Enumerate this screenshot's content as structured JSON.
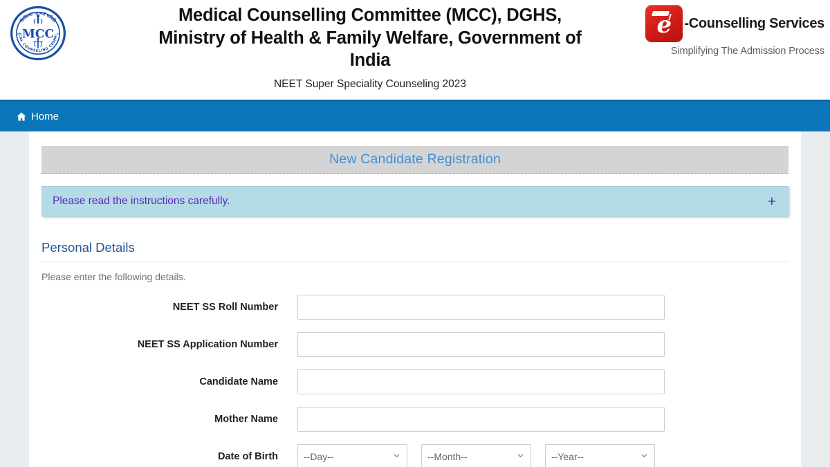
{
  "header": {
    "title": "Medical Counselling Committee (MCC), DGHS, Ministry of Health & Family Welfare, Government of India",
    "subtitle": "NEET Super Speciality Counseling 2023",
    "left_logo_alt": "mcc-seal-logo",
    "right_logo": {
      "name": "-Counselling Services",
      "tagline": "Simplifying The Admission Process",
      "badge_letter": "e"
    }
  },
  "nav": {
    "items": [
      {
        "label": "Home",
        "icon": "home-icon"
      }
    ]
  },
  "panel": {
    "title": "New Candidate Registration"
  },
  "alert": {
    "text": "Please read the instructions carefully.",
    "toggle": "+"
  },
  "section": {
    "title": "Personal Details",
    "subtitle": "Please enter the following details."
  },
  "form": {
    "fields": [
      {
        "label": "NEET SS Roll Number",
        "value": "",
        "placeholder": "",
        "type": "text"
      },
      {
        "label": "NEET SS Application Number",
        "value": "",
        "placeholder": "",
        "type": "text"
      },
      {
        "label": "Candidate Name",
        "value": "",
        "placeholder": "",
        "type": "text"
      },
      {
        "label": "Mother Name",
        "value": "",
        "placeholder": "",
        "type": "text"
      }
    ],
    "dob": {
      "label": "Date of Birth",
      "day": "--Day--",
      "month": "--Month--",
      "year": "--Year--"
    }
  },
  "colors": {
    "nav_blue": "#0b76b8",
    "panel_gray": "#d4d4d4",
    "panel_title_blue": "#3f8fd6",
    "alert_bg": "#b3dce6",
    "alert_text": "#6026b8",
    "section_blue": "#215a92",
    "page_bg": "#e9edf0",
    "brand_red": "#cf1a16"
  }
}
